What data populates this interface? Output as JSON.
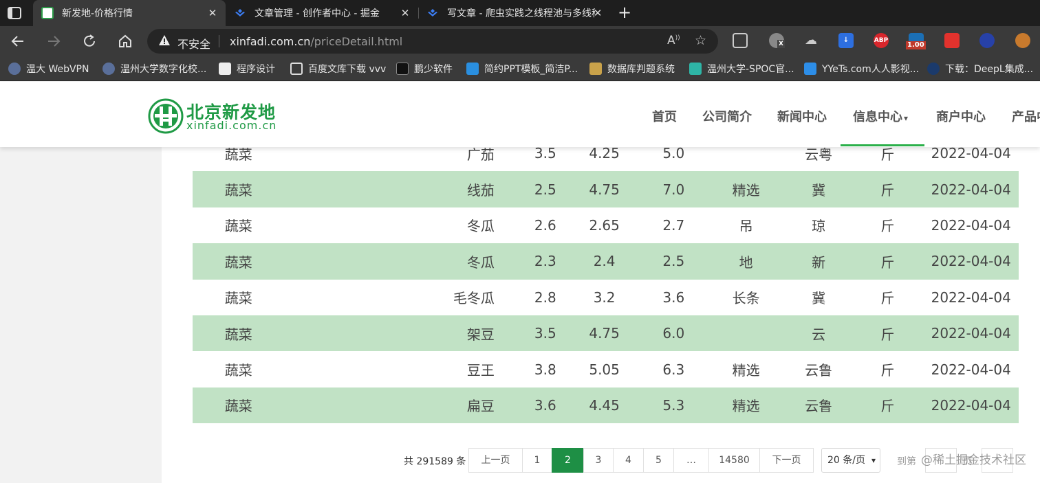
{
  "browser": {
    "tabs": [
      {
        "title": "新发地-价格行情",
        "favicon": "xinfadi-logo-icon",
        "active": true
      },
      {
        "title": "文章管理 - 创作者中心 - 掘金",
        "favicon": "juejin-icon",
        "active": false
      },
      {
        "title": "写文章 - 爬虫实践之线程池与多线程",
        "favicon": "juejin-icon",
        "active": false
      }
    ],
    "new_tab_label": "+",
    "close_glyph": "✕",
    "address": {
      "security_label": "不安全",
      "domain": "xinfadi.com.cn",
      "path": "/priceDetail.html"
    },
    "extensions": [
      {
        "name": "collections-icon"
      },
      {
        "name": "extension-x-icon",
        "badge": "X"
      },
      {
        "name": "cloud-extension-icon"
      },
      {
        "name": "download-extension-icon"
      },
      {
        "name": "adblock-plus-icon",
        "label": "ABP"
      },
      {
        "name": "video-speed-icon",
        "badge": "1.00"
      },
      {
        "name": "red-cube-icon"
      },
      {
        "name": "blue-extension-icon"
      },
      {
        "name": "cookie-icon"
      }
    ],
    "bookmarks": [
      {
        "label": "温大 WebVPN",
        "icon": "webvpn-icon"
      },
      {
        "label": "温州大学数字化校...",
        "icon": "university-icon"
      },
      {
        "label": "程序设计",
        "icon": "program-icon"
      },
      {
        "label": "百度文库下载 vvv",
        "icon": "document-icon"
      },
      {
        "label": "鹏少软件",
        "icon": "software-icon"
      },
      {
        "label": "简约PPT模板_简洁P...",
        "icon": "ppt-icon"
      },
      {
        "label": "数据库判题系统",
        "icon": "database-icon"
      },
      {
        "label": "温州大学-SPOC官...",
        "icon": "book-icon"
      },
      {
        "label": "YYeTs.com人人影视...",
        "icon": "yyets-icon"
      },
      {
        "label": "下载：DeepL集成...",
        "icon": "deepl-icon"
      }
    ]
  },
  "site": {
    "logo_cn": "北京新发地",
    "logo_en": "xinfadi.com.cn",
    "nav": [
      "首页",
      "公司简介",
      "新闻中心",
      "信息中心",
      "商户中心",
      "产品中"
    ],
    "nav_dropdown_glyph": "▾"
  },
  "table": {
    "rows": [
      [
        "蔬菜",
        "广茄",
        "3.5",
        "4.25",
        "5.0",
        "",
        "云粤",
        "斤",
        "2022-04-04"
      ],
      [
        "蔬菜",
        "线茄",
        "2.5",
        "4.75",
        "7.0",
        "精选",
        "冀",
        "斤",
        "2022-04-04"
      ],
      [
        "蔬菜",
        "冬瓜",
        "2.6",
        "2.65",
        "2.7",
        "吊",
        "琼",
        "斤",
        "2022-04-04"
      ],
      [
        "蔬菜",
        "冬瓜",
        "2.3",
        "2.4",
        "2.5",
        "地",
        "新",
        "斤",
        "2022-04-04"
      ],
      [
        "蔬菜",
        "毛冬瓜",
        "2.8",
        "3.2",
        "3.6",
        "长条",
        "冀",
        "斤",
        "2022-04-04"
      ],
      [
        "蔬菜",
        "架豆",
        "3.5",
        "4.75",
        "6.0",
        "",
        "云",
        "斤",
        "2022-04-04"
      ],
      [
        "蔬菜",
        "豆王",
        "3.8",
        "5.05",
        "6.3",
        "精选",
        "云鲁",
        "斤",
        "2022-04-04"
      ],
      [
        "蔬菜",
        "扁豆",
        "3.6",
        "4.45",
        "5.3",
        "精选",
        "云鲁",
        "斤",
        "2022-04-04"
      ]
    ]
  },
  "pagination": {
    "total": "共 291589 条",
    "prev": "上一页",
    "pages": [
      "1",
      "2",
      "3",
      "4",
      "5",
      "…",
      "14580"
    ],
    "current": "2",
    "next": "下一页",
    "page_size": "20 条/页",
    "goto_label": "到第",
    "goto_suffix": "页"
  },
  "watermark": "@稀土掘金技术社区",
  "colors": {
    "row_highlight": "#c1e2c5",
    "brand_green": "#1f9a45",
    "current_page": "#1e8f45"
  }
}
